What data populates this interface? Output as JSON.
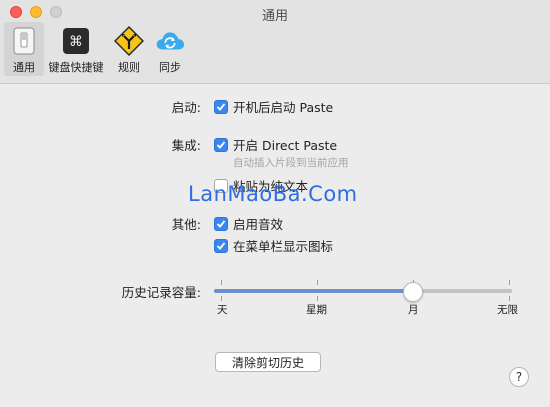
{
  "window": {
    "title": "通用"
  },
  "tabs": [
    {
      "label": "通用",
      "icon": "general-switch-icon"
    },
    {
      "label": "键盘快捷键",
      "icon": "keyboard-command-icon"
    },
    {
      "label": "规则",
      "icon": "rules-sign-icon"
    },
    {
      "label": "同步",
      "icon": "sync-cloud-icon"
    }
  ],
  "startup": {
    "label": "启动:",
    "option": "开机后启动 Paste",
    "checked": true
  },
  "integration": {
    "label": "集成:",
    "option": "开启 Direct Paste",
    "checked": true,
    "hint": "自动插入片段到当前应用",
    "plain_text": "粘贴为纯文本",
    "plain_checked": false
  },
  "watermark": "LanMaoBa.Com",
  "other": {
    "label": "其他:",
    "sound": "启用音效",
    "sound_checked": true,
    "menubar": "在菜单栏显示图标",
    "menubar_checked": true
  },
  "history": {
    "label": "历史记录容量:",
    "ticks": [
      "天",
      "星期",
      "月",
      "无限"
    ],
    "selected_index": 2
  },
  "clear_button": "清除剪切历史",
  "help": "?",
  "colors": {
    "accent": "#3a86ef",
    "slider_fill": "#6e8fcf"
  }
}
